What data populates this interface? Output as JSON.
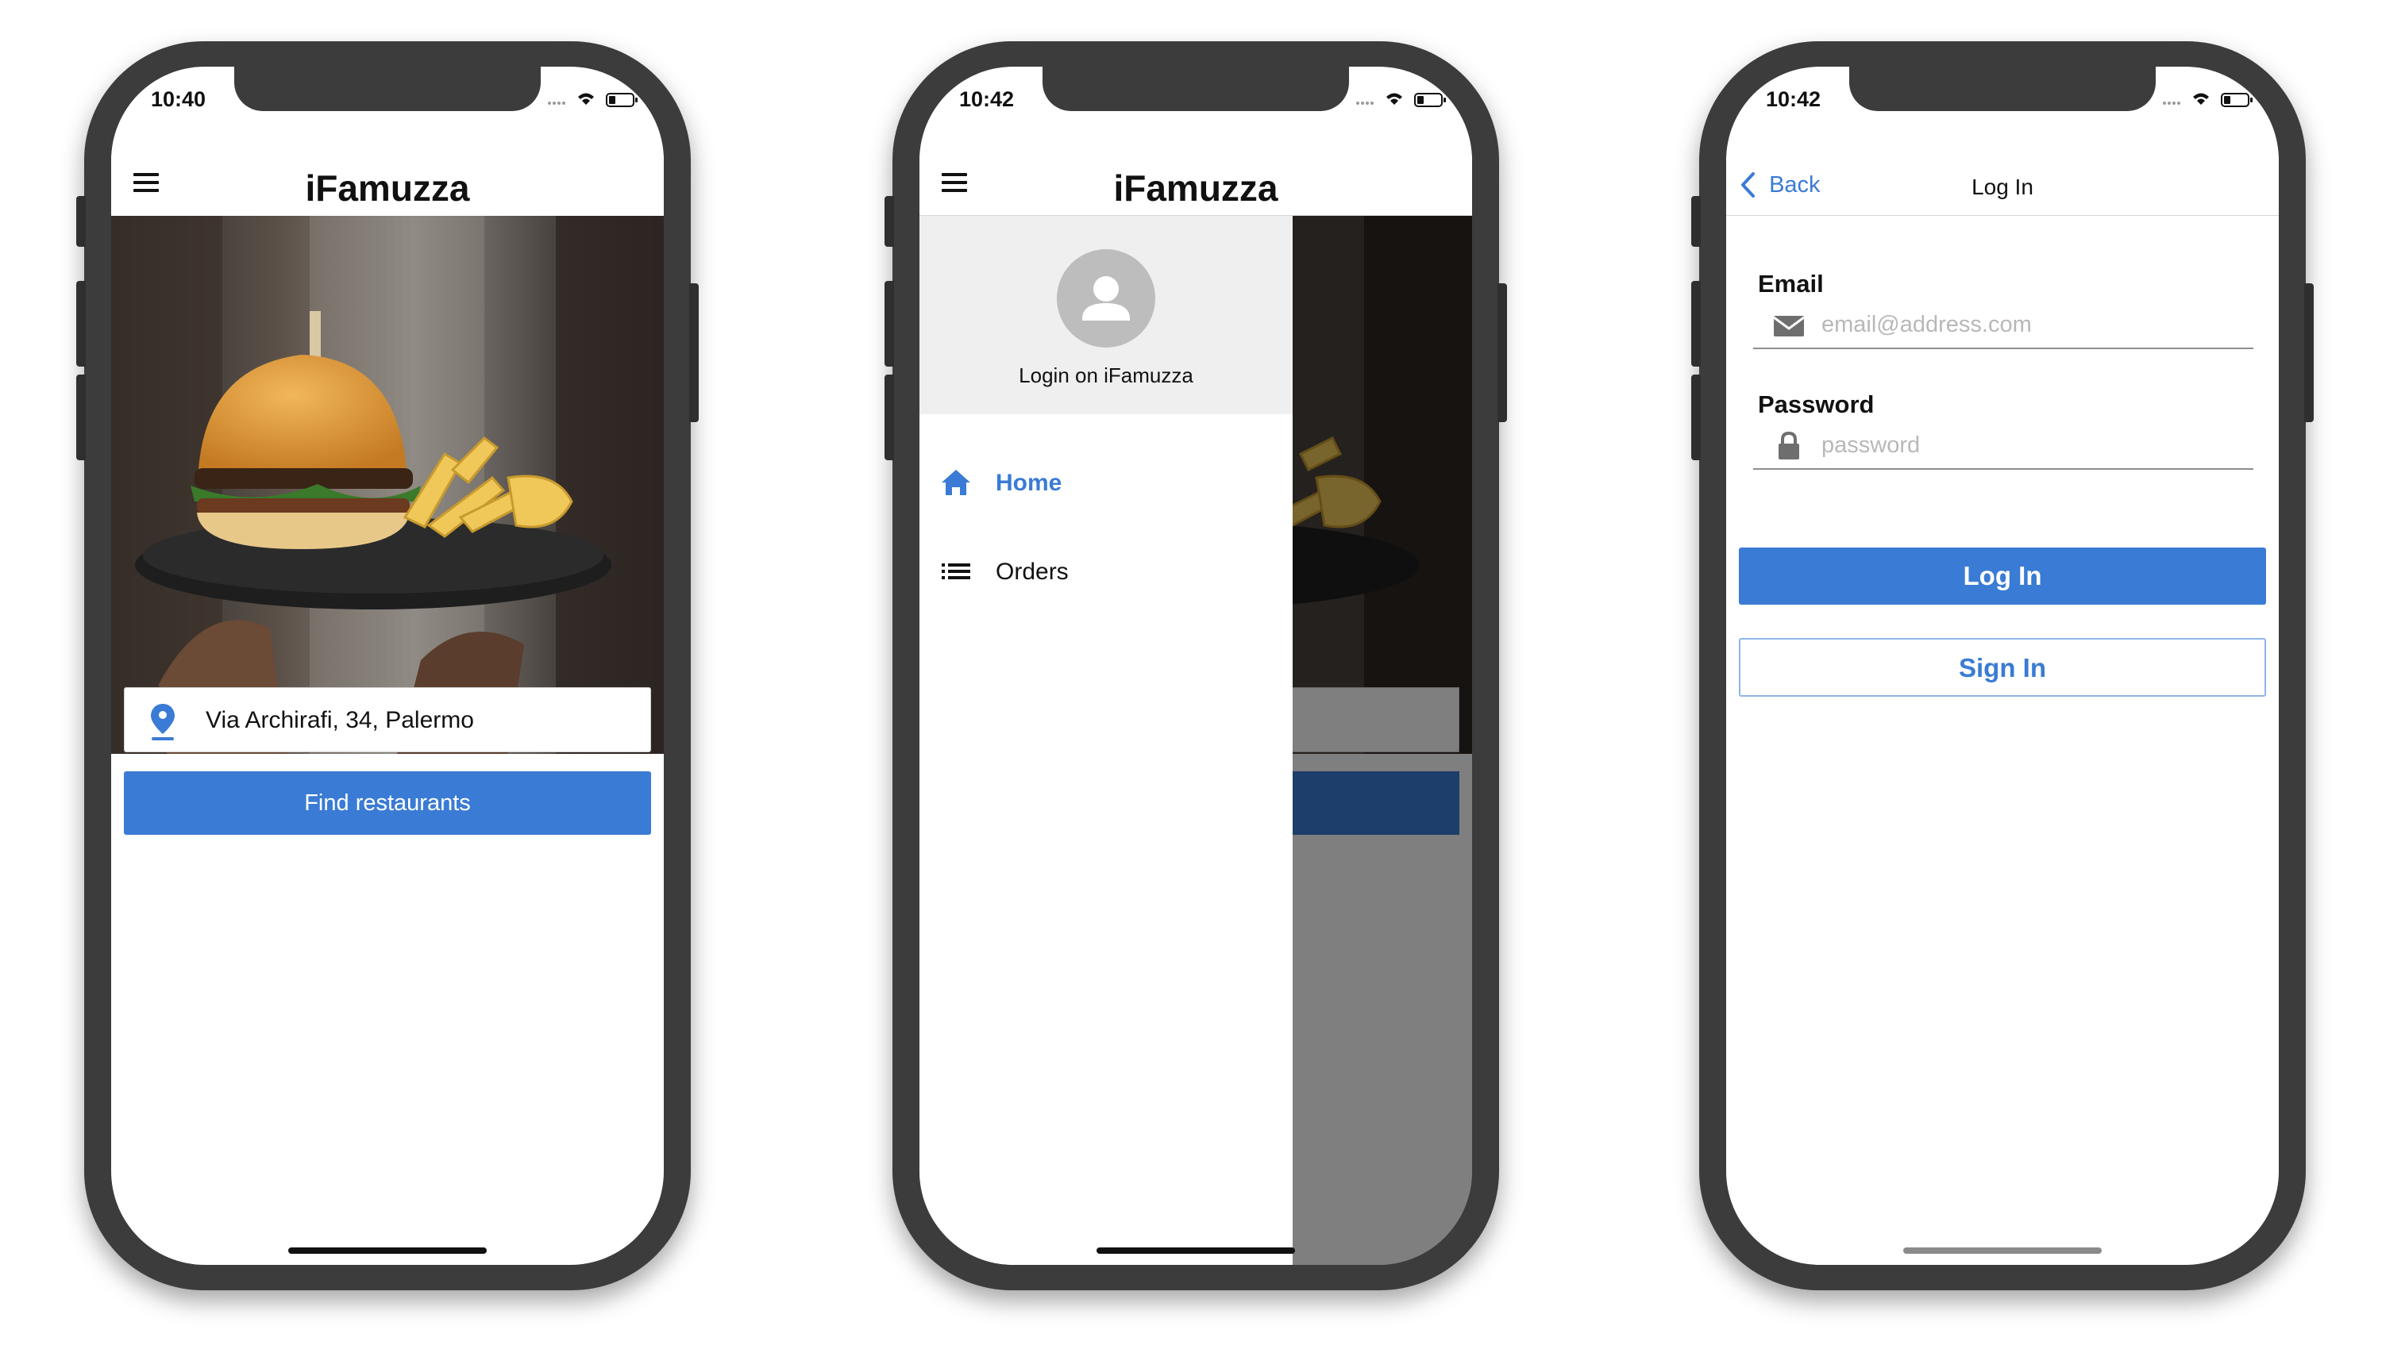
{
  "phones": [
    {
      "status_time": "10:40",
      "app_title": "iFamuzza",
      "address_value": "Via Archirafi, 34, Palermo",
      "find_button": "Find restaurants"
    },
    {
      "status_time": "10:42",
      "app_title": "iFamuzza",
      "drawer_login_text": "Login on iFamuzza",
      "menu": [
        {
          "label": "Home",
          "icon": "home-icon",
          "active": true
        },
        {
          "label": "Orders",
          "icon": "list-icon",
          "active": false
        }
      ]
    },
    {
      "status_time": "10:42",
      "back_label": "Back",
      "nav_title": "Log In",
      "email_label": "Email",
      "email_placeholder": "email@address.com",
      "password_label": "Password",
      "password_placeholder": "password",
      "login_button": "Log In",
      "signin_button": "Sign In"
    }
  ],
  "colors": {
    "accent": "#3a7bd5",
    "phone_frame": "#3c3c3c",
    "drawer_header": "#efefef"
  }
}
